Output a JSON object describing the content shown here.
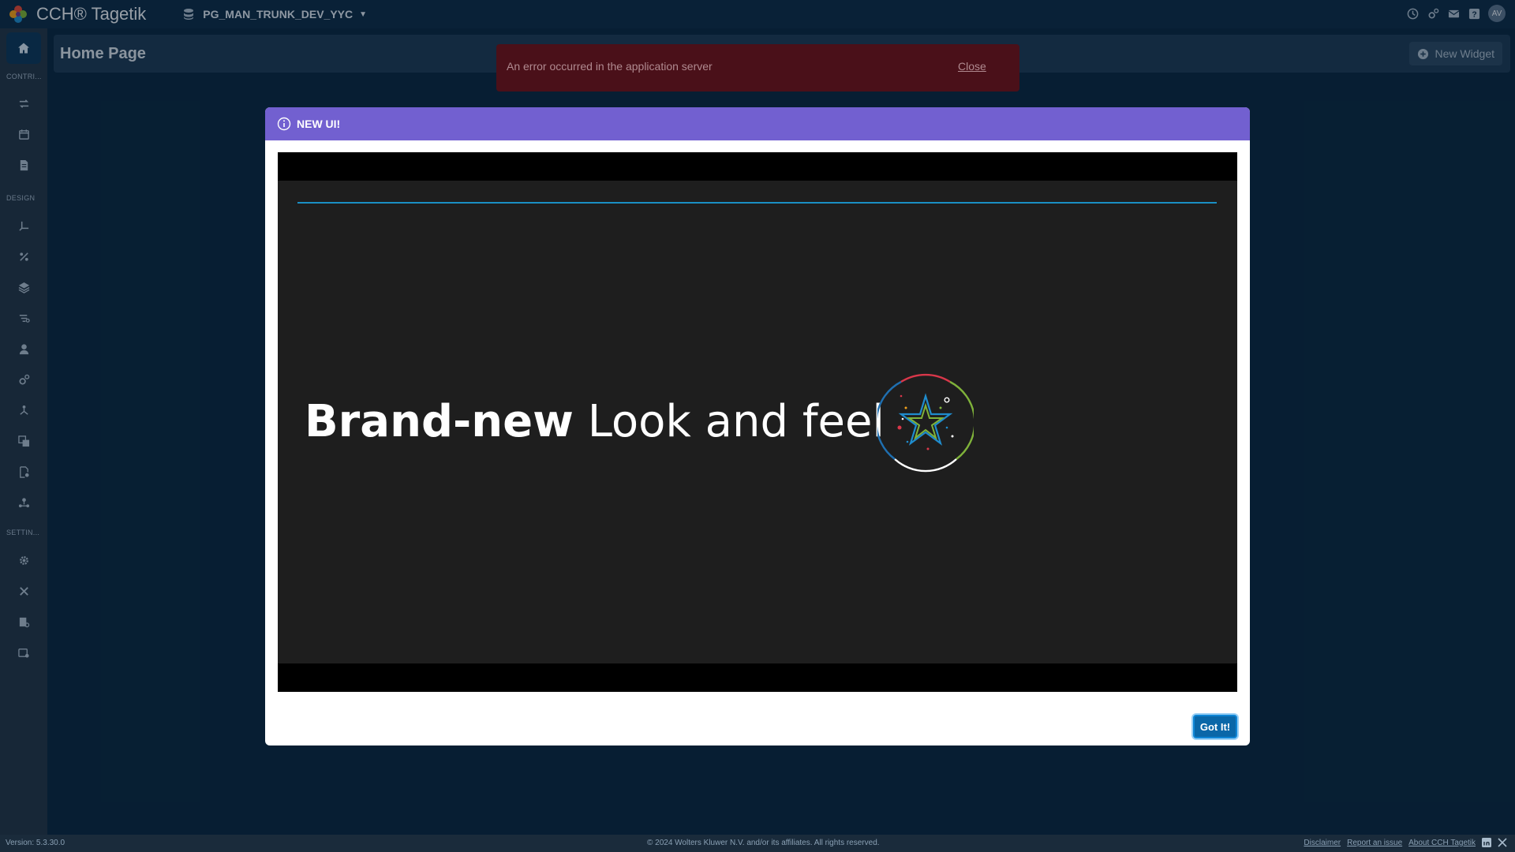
{
  "app": {
    "title": "CCH® Tagetik",
    "environment": "PG_MAN_TRUNK_DEV_YYC",
    "avatar_initials": "AV"
  },
  "sidebar": {
    "sections": [
      {
        "label": "CONTRI..."
      },
      {
        "label": "DESIGN"
      },
      {
        "label": "SETTIN..."
      }
    ]
  },
  "page": {
    "title": "Home Page",
    "new_widget_label": "New Widget"
  },
  "error_toast": {
    "message": "An error occurred in the application server",
    "close_label": "Close"
  },
  "modal": {
    "title": "NEW UI!",
    "headline_bold": "Brand-new",
    "headline_light": "Look and feel",
    "confirm_label": "Got It!"
  },
  "footer": {
    "version": "Version: 5.3.30.0",
    "copyright": "© 2024 Wolters Kluwer N.V. and/or its affiliates. All rights reserved.",
    "links": [
      "Disclaimer",
      "Report an issue",
      "About CCH Tagetik"
    ]
  },
  "colors": {
    "modal_header": "#7260d0",
    "error_bg": "#4a1019",
    "primary_button": "#0a67a8",
    "progress": "#1a8fc4"
  }
}
